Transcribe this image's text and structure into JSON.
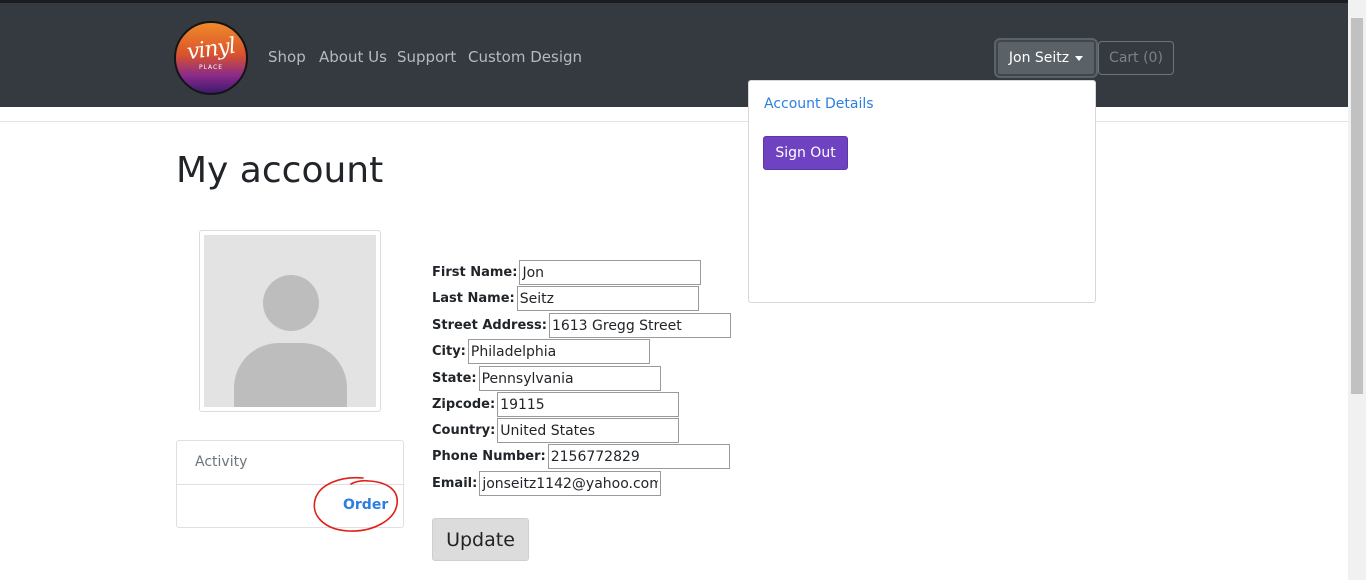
{
  "brand": {
    "logo_text": "vinyl",
    "logo_subtext": "PLACE"
  },
  "nav": {
    "links": [
      "Shop",
      "About Us",
      "Support",
      "Custom Design"
    ],
    "user_label": "Jon Seitz",
    "cart_label": "Cart (0)"
  },
  "dropdown": {
    "account_details": "Account Details",
    "sign_out": "Sign Out"
  },
  "page": {
    "title": "My account"
  },
  "activity": {
    "header": "Activity",
    "order_link": "Order"
  },
  "form": {
    "fields": [
      {
        "label": "First Name:",
        "value": "Jon"
      },
      {
        "label": "Last Name:",
        "value": "Seitz"
      },
      {
        "label": "Street Address:",
        "value": "1613 Gregg Street"
      },
      {
        "label": "City:",
        "value": "Philadelphia"
      },
      {
        "label": "State:",
        "value": "Pennsylvania"
      },
      {
        "label": "Zipcode:",
        "value": "19115"
      },
      {
        "label": "Country:",
        "value": "United States"
      },
      {
        "label": "Phone Number:",
        "value": "2156772829"
      },
      {
        "label": "Email:",
        "value": "jonseitz1142@yahoo.com"
      }
    ],
    "update_label": "Update"
  },
  "colors": {
    "navbar": "#343a40",
    "link": "#2c7ee0",
    "signout": "#6f42c1",
    "annotation": "#e0201a"
  }
}
